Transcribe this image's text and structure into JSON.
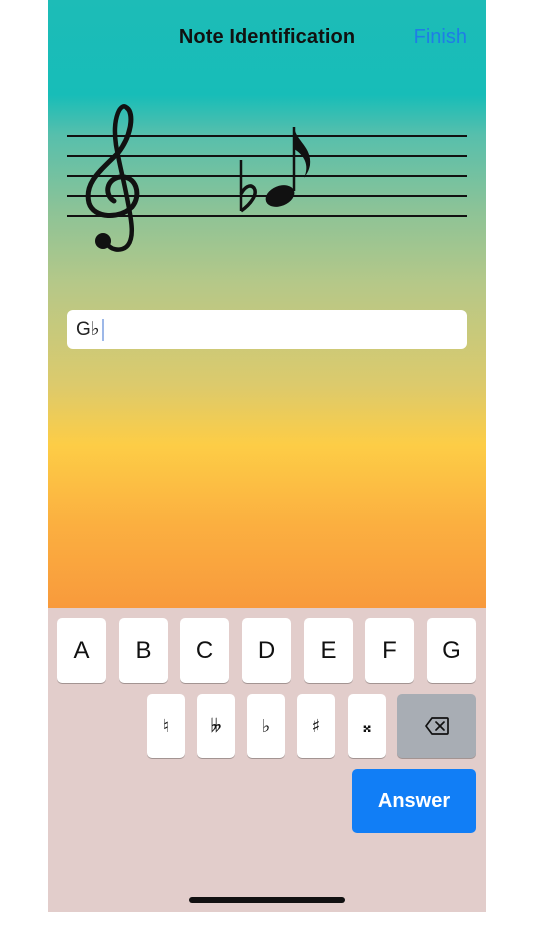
{
  "nav": {
    "title": "Note Identification",
    "finish_label": "Finish"
  },
  "answer_field": {
    "value": "G♭"
  },
  "keyboard": {
    "letters": [
      "A",
      "B",
      "C",
      "D",
      "E",
      "F",
      "G"
    ],
    "accidentals": [
      "♮",
      "𝄫",
      "♭",
      "♯",
      "𝄪"
    ],
    "answer_label": "Answer"
  },
  "colors": {
    "accent": "#117ef6",
    "finish_link": "#1f7de6",
    "keyboard_bg": "#e2cdcb",
    "backspace_key": "#a8adb4"
  },
  "icons": {
    "backspace": "backspace-icon",
    "clef": "treble-clef-icon",
    "note": "eighth-note-icon",
    "accidental": "flat-icon"
  }
}
